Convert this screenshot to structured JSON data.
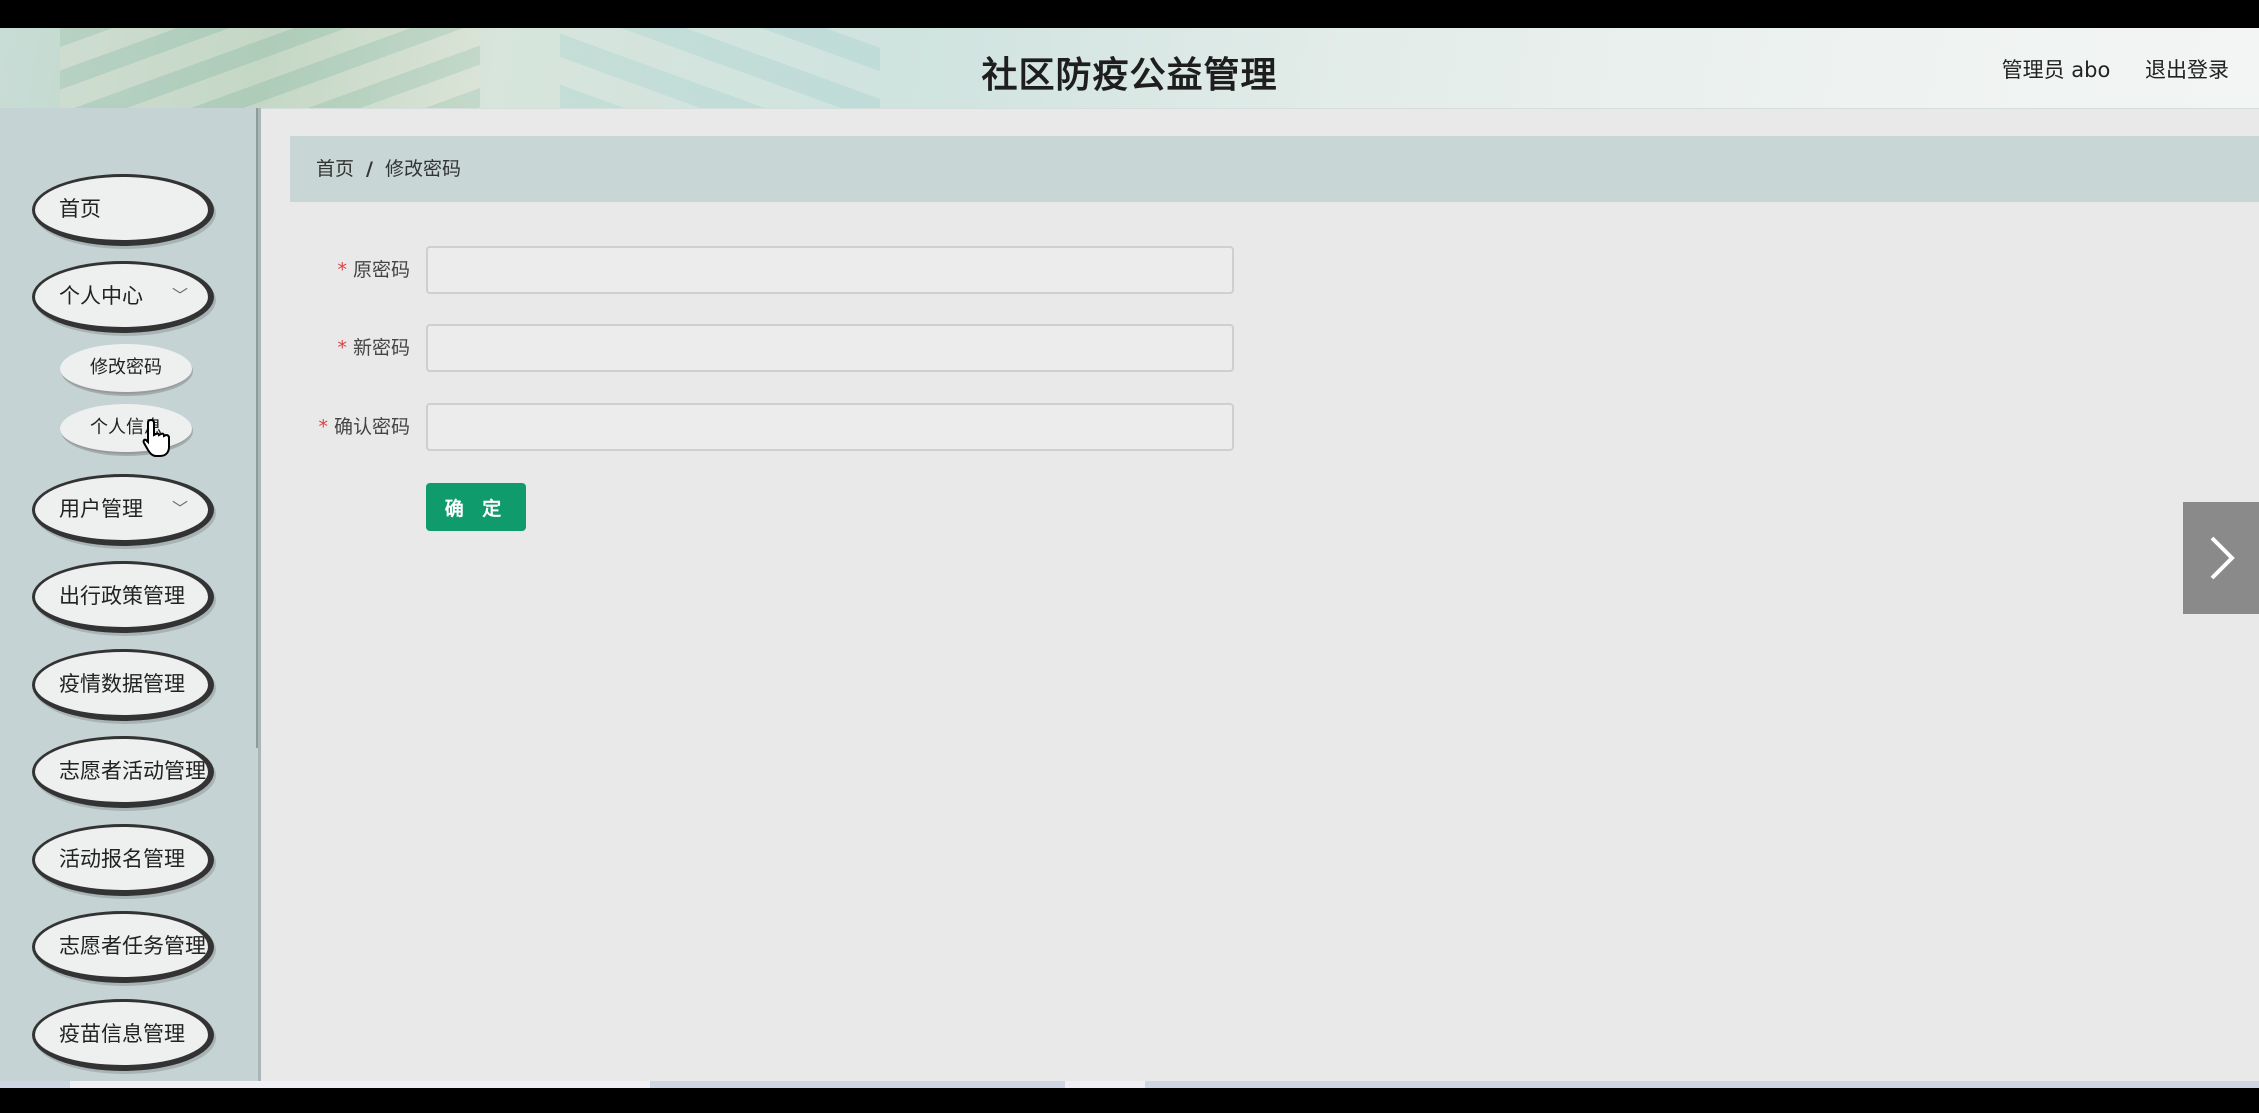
{
  "header": {
    "title": "社区防疫公益管理",
    "user_label": "管理员 abo",
    "logout_label": "退出登录"
  },
  "sidebar": {
    "items": [
      {
        "label": "首页"
      },
      {
        "label": "个人中心",
        "expanded": true,
        "children": [
          {
            "label": "修改密码"
          },
          {
            "label": "个人信息"
          }
        ]
      },
      {
        "label": "用户管理"
      },
      {
        "label": "出行政策管理"
      },
      {
        "label": "疫情数据管理"
      },
      {
        "label": "志愿者活动管理"
      },
      {
        "label": "活动报名管理"
      },
      {
        "label": "志愿者任务管理"
      },
      {
        "label": "疫苗信息管理"
      }
    ]
  },
  "breadcrumb": {
    "home": "首页",
    "separator": "/",
    "current": "修改密码"
  },
  "form": {
    "required_mark": "*",
    "fields": [
      {
        "label": "原密码",
        "value": ""
      },
      {
        "label": "新密码",
        "value": ""
      },
      {
        "label": "确认密码",
        "value": ""
      }
    ],
    "submit_label": "确 定"
  },
  "icons": {
    "chevron": "chevron-down-icon",
    "next": "chevron-right-icon",
    "cursor": "hand-pointer-icon"
  },
  "colors": {
    "submit": "#0f9b6c",
    "required": "#e04040"
  }
}
